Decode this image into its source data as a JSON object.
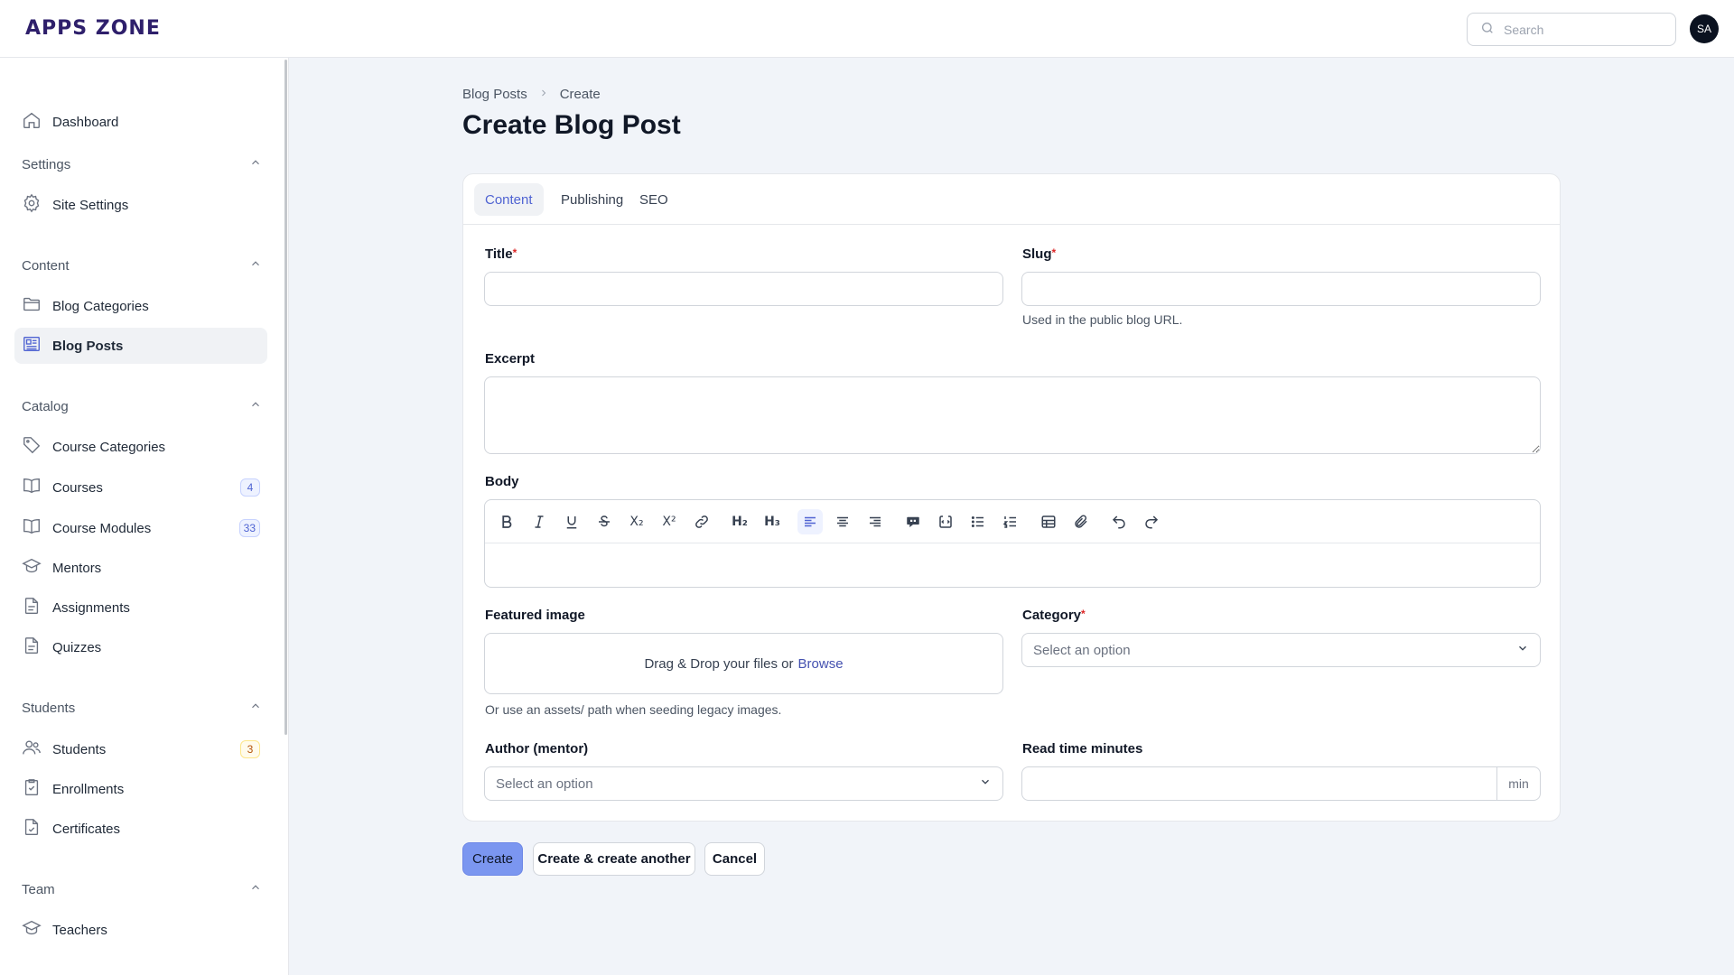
{
  "app": {
    "brand": "APPS ZONE"
  },
  "header": {
    "search_placeholder": "Search",
    "avatar_initials": "SA"
  },
  "sidebar": {
    "dashboard": "Dashboard",
    "groups": {
      "settings": {
        "label": "Settings",
        "items": [
          "Site Settings"
        ]
      },
      "content": {
        "label": "Content",
        "items": [
          "Blog Categories",
          "Blog Posts"
        ]
      },
      "catalog": {
        "label": "Catalog",
        "items": [
          "Course Categories",
          "Courses",
          "Course Modules",
          "Mentors",
          "Assignments",
          "Quizzes"
        ]
      },
      "students": {
        "label": "Students",
        "items": [
          "Students",
          "Enrollments",
          "Certificates"
        ]
      },
      "team": {
        "label": "Team",
        "items": [
          "Teachers"
        ]
      }
    },
    "badges": {
      "courses": "4",
      "course_modules": "33",
      "students": "3"
    },
    "active_item": "Blog Posts"
  },
  "breadcrumb": {
    "parent": "Blog Posts",
    "current": "Create"
  },
  "page": {
    "title": "Create Blog Post"
  },
  "tabs": [
    "Content",
    "Publishing",
    "SEO"
  ],
  "active_tab": "Content",
  "form": {
    "title_label": "Title",
    "slug_label": "Slug",
    "slug_hint": "Used in the public blog URL.",
    "excerpt_label": "Excerpt",
    "body_label": "Body",
    "featured_image_label": "Featured image",
    "dropzone_text": "Drag & Drop your files or",
    "dropzone_link": "Browse",
    "featured_image_hint": "Or use an assets/ path when seeding legacy images.",
    "category_label": "Category",
    "category_placeholder": "Select an option",
    "author_label": "Author (mentor)",
    "author_placeholder": "Select an option",
    "read_time_label": "Read time minutes",
    "read_time_suffix": "min",
    "required_marker": "*"
  },
  "toolbar_tools": [
    "bold",
    "italic",
    "underline",
    "strike",
    "subscript",
    "superscript",
    "link",
    "h2",
    "h3",
    "align-left",
    "align-center",
    "align-right",
    "blockquote",
    "code-block",
    "bullet-list",
    "ordered-list",
    "table",
    "attach",
    "undo",
    "redo"
  ],
  "toolbar_glyphs": {
    "subscript": "X₂",
    "superscript": "X²",
    "h2": "H₂",
    "h3": "H₃"
  },
  "actions": {
    "create": "Create",
    "create_another": "Create & create another",
    "cancel": "Cancel"
  },
  "colors": {
    "accent": "#4f63d2",
    "primary_button": "#7b96f0",
    "brand": "#2e1f6b"
  }
}
